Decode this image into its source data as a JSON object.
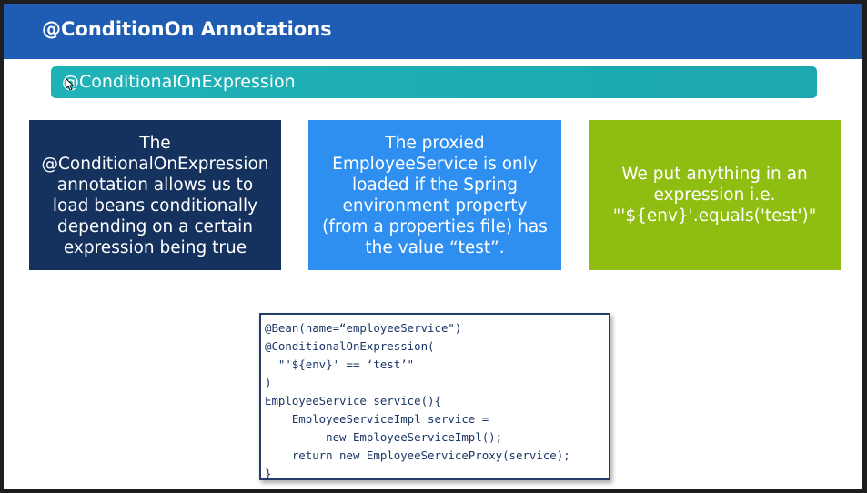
{
  "slide": {
    "title": "@ConditionOn Annotations",
    "subtitle": "@ConditionalOnExpression",
    "boxes": [
      {
        "lines": [
          "The",
          "@ConditionalOnExpression",
          "annotation allows us to",
          "load beans conditionally",
          "depending on a certain",
          "expression being true"
        ],
        "color": "#15325e"
      },
      {
        "lines": [
          "The proxied",
          "EmployeeService is only",
          "loaded if the Spring",
          "environment property",
          "(from a properties file) has",
          "the value “test”."
        ],
        "color": "#2f8ff0"
      },
      {
        "lines": [
          "We put anything in an",
          "expression i.e.",
          "\"'${env}'.equals('test')\""
        ],
        "color": "#8fbd11"
      }
    ],
    "code_lines": [
      "@Bean(name=“employeeService\")",
      "@ConditionalOnExpression(",
      "  \"'${env}' == ‘test’\"",
      ")",
      "EmployeeService service(){",
      "    EmployeeServiceImpl service =",
      "         new EmployeeServiceImpl();",
      "    return new EmployeeServiceProxy(service);",
      "}"
    ]
  },
  "colors": {
    "title_bar": "#1f5cb3",
    "subtitle_bar": "#1fb3b8",
    "code_text": "#1a3566",
    "code_border": "#243c68"
  },
  "icons": {
    "cursor": "mouse-pointer-icon"
  }
}
